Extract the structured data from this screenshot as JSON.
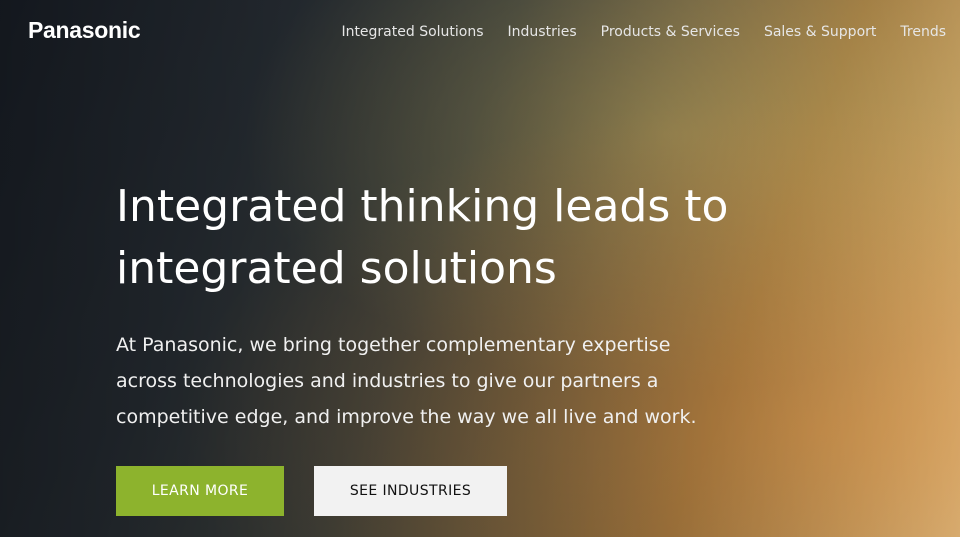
{
  "brand": {
    "logo_text": "Panasonic"
  },
  "nav": {
    "items": [
      "Integrated Solutions",
      "Industries",
      "Products & Services",
      "Sales & Support",
      "Trends"
    ]
  },
  "hero": {
    "headline_line1": "Integrated thinking leads to",
    "headline_line2": "integrated solutions",
    "subtext_line1": "At Panasonic, we bring together complementary expertise",
    "subtext_line2": "across technologies and industries to give our partners a",
    "subtext_line3": "competitive edge, and improve the way we all live and work.",
    "primary_cta": "LEARN MORE",
    "secondary_cta": "SEE INDUSTRIES"
  },
  "colors": {
    "accent": "#8db32d",
    "secondary_button": "#f2f2f2"
  }
}
